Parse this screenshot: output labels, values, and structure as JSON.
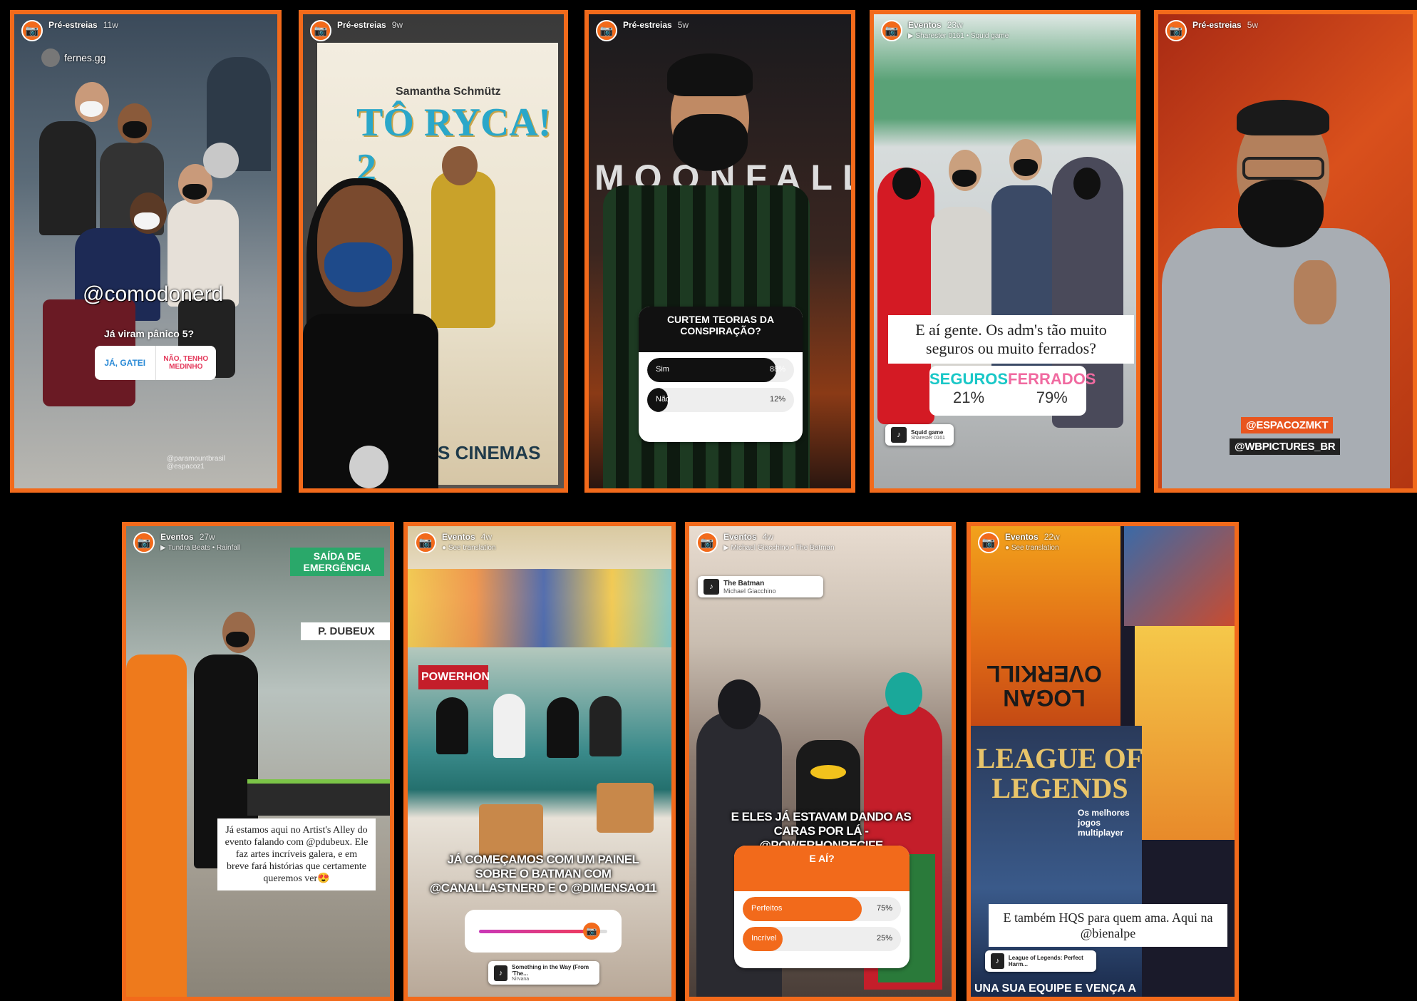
{
  "stories": [
    {
      "id": "s1",
      "header": "Pré-estreias",
      "age": "11w",
      "subline": "fernes.gg",
      "mention": "@comodonerd",
      "question": "Já viram pânico 5?",
      "options": [
        "JÁ, GATEI",
        "NÃO, TENHO MEDINHO"
      ],
      "corner_text": "@paramountbrasil @espacoz1"
    },
    {
      "id": "s2",
      "header": "Pré-estreias",
      "age": "9w",
      "poster_author": "Samantha Schmütz",
      "poster_title": "TÔ RYCA! 2",
      "poster_bottom": "NOS CINEMAS"
    },
    {
      "id": "s3",
      "header": "Pré-estreias",
      "age": "5w",
      "poster_title": "MOONFALL",
      "poll": {
        "question": "CURTEM TEORIAS DA CONSPIRAÇÃO?",
        "options": [
          {
            "label": "Sim",
            "pct": "88%",
            "fraction": 0.88
          },
          {
            "label": "Não",
            "pct": "12%",
            "fraction": 0.12
          }
        ]
      }
    },
    {
      "id": "s4",
      "header": "Eventos",
      "age": "23w",
      "subline": "Sharester 0161 • Squid game",
      "caption": "E aí gente. Os adm's tão muito seguros ou muito ferrados?",
      "poll": [
        {
          "label": "SEGUROS",
          "pct": "21%"
        },
        {
          "label": "FERRADOS",
          "pct": "79%"
        }
      ],
      "music": {
        "title": "Squid game",
        "artist": "Sharester 0161"
      }
    },
    {
      "id": "s5",
      "header": "Pré-estreias",
      "age": "5w",
      "tags": [
        "@ESPACOZMKT",
        "@WBPICTURES_BR"
      ]
    },
    {
      "id": "s6",
      "header": "Eventos",
      "age": "27w",
      "subline": "Tundra Beats • Rainfall",
      "sign": "SAÍDA DE EMERGÊNCIA",
      "stand": "P. DUBEUX",
      "caption": "Já estamos aqui no Artist's Alley do evento falando com @pdubeux. Ele faz artes incríveis galera, e em breve fará histórias que certamente queremos ver😍"
    },
    {
      "id": "s7",
      "header": "Eventos",
      "age": "4w",
      "subline": "See translation",
      "banner": "POWERHON",
      "caption": "JÁ COMEÇAMOS COM UM PAINEL SOBRE O BATMAN COM @CANALLASTNERD E O @DIMENSAO11",
      "slider_emoji": "📷",
      "slider_level": 0.88,
      "music": {
        "title": "Something in the Way (From 'The...",
        "artist": "Nirvana"
      }
    },
    {
      "id": "s8",
      "header": "Eventos",
      "age": "4w",
      "subline": "Michael Giacchino • The Batman",
      "music": {
        "title": "The Batman",
        "artist": "Michael Giacchino"
      },
      "caption": "E ELES JÁ ESTAVAM DANDO AS CARAS POR LÁ - @POWERHONRECIFE",
      "poll": {
        "question": "E AÍ?",
        "options": [
          {
            "label": "Perfeitos",
            "pct": "75%",
            "fraction": 0.75
          },
          {
            "label": "Incrível",
            "pct": "25%",
            "fraction": 0.25
          }
        ]
      }
    },
    {
      "id": "s9",
      "header": "Eventos",
      "age": "22w",
      "subline": "See translation",
      "magazine1": "LOGAN OVERKILL",
      "magazine2": "LEAGUE OF LEGENDS",
      "magazine2_sub": "Os melhores jogos multiplayer",
      "caption": "E também HQS para quem ama. Aqui na @bienalpe",
      "music": {
        "title": "League of Legends: Perfect Harm...",
        "artist": ""
      },
      "bottom_text": "UNA SUA EQUIPE E VENÇA A"
    }
  ],
  "colors": {
    "border": "#f26a1b",
    "background": "#000000",
    "accent": "#f26a1b"
  },
  "icons": {
    "avatar": "camera-icon"
  }
}
